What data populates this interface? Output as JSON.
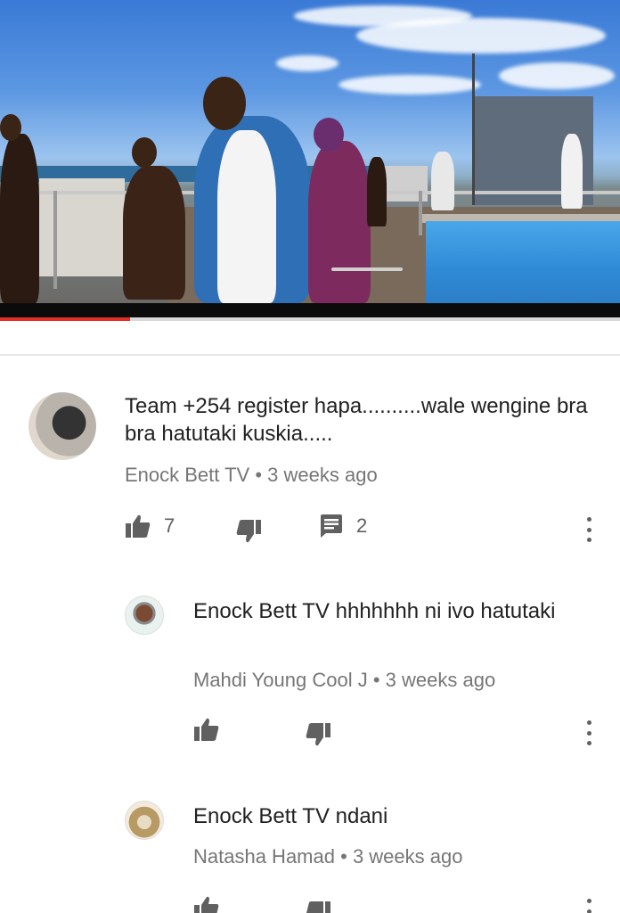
{
  "video": {
    "progress_percent": 21
  },
  "comments": [
    {
      "text": "Team +254 register hapa..........wale wengine bra bra hatutaki kuskia.....",
      "author": "Enock Bett TV",
      "separator": "•",
      "time": "3 weeks ago",
      "likes": "7",
      "replies": "2"
    },
    {
      "text": "Enock Bett TV hhhhhhh ni ivo hatutaki",
      "author": "Mahdi Young Cool J",
      "separator": "•",
      "time": "3 weeks ago"
    },
    {
      "text": "Enock Bett TV ndani",
      "author": "Natasha Hamad",
      "separator": "•",
      "time": "3 weeks ago"
    }
  ],
  "icons": {
    "like": "thumbs-up-icon",
    "dislike": "thumbs-down-icon",
    "reply": "comment-icon",
    "more": "more-vertical-icon"
  },
  "colors": {
    "progress": "#e52d27",
    "text": "#212121",
    "meta": "#767676",
    "icon": "#606060"
  }
}
